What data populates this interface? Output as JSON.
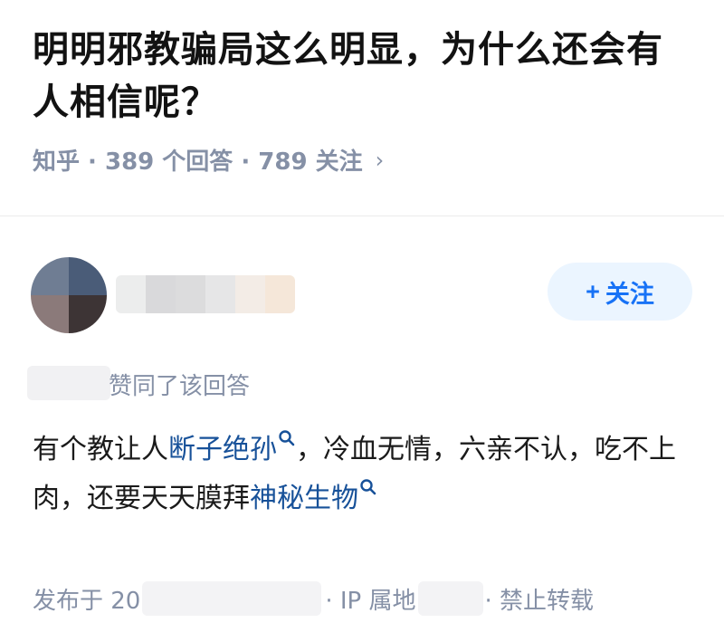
{
  "question": {
    "title": "明明邪教骗局这么明显，为什么还会有人相信呢？",
    "meta": "知乎 · 389 个回答 · 789 关注",
    "chevron": "›"
  },
  "author": {
    "follow_plus": "+",
    "follow_label": "关注"
  },
  "liker": {
    "text": "赞同了该回答"
  },
  "answer": {
    "segments": {
      "s1": "有个教让人",
      "link1": "断子绝孙",
      "s2": "，冷血无情，六亲不认，吃不上肉，还要天天膜拜",
      "link2": "神秘生物"
    }
  },
  "footer": {
    "published_prefix": "发布于 20",
    "ip_label": "· IP 属地",
    "no_repost": "· 禁止转载"
  },
  "colors": {
    "link": "#175199",
    "accent": "#1772f6",
    "meta_gray": "#8590a6"
  },
  "icons": {
    "chevron": "chevron-right-icon",
    "search": "search-icon"
  }
}
